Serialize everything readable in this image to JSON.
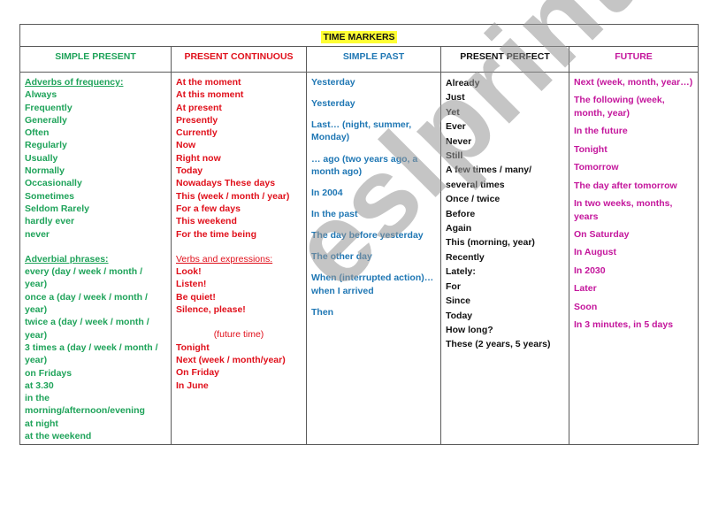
{
  "title": "TIME MARKERS",
  "columns": [
    {
      "heading": "SIMPLE PRESENT",
      "color": "#1fa35a",
      "section1_heading": "Adverbs of frequency:",
      "section1_items": [
        "Always",
        "Frequently",
        "Generally",
        "Often",
        "Regularly",
        "Usually",
        "Normally",
        "Occasionally",
        "Sometimes",
        "Seldom Rarely",
        "hardly ever",
        "never"
      ],
      "section2_heading": "Adverbial phrases:",
      "section2_items": [
        "every (day / week / month / year)",
        "once a (day / week / month / year)",
        "twice a (day / week / month / year)",
        "3 times a (day / week / month / year)",
        "on Fridays",
        "at 3.30",
        "in the morning/afternoon/evening",
        "at night",
        "at the weekend"
      ]
    },
    {
      "heading": "PRESENT CONTINUOUS",
      "color": "#e0101b",
      "section1_items": [
        "At the moment",
        "At this moment",
        "At present",
        "Presently",
        "Currently",
        "Now",
        "Right now",
        "Today",
        "Nowadays These days",
        "This (week / month / year)",
        "For a few days",
        "This weekend",
        "For the time being"
      ],
      "section2_heading": "Verbs and expressions:",
      "section2_items": [
        "Look!",
        "Listen!",
        "Be quiet!",
        "Silence, please!"
      ],
      "section3_heading": "(future time)",
      "section3_items": [
        "Tonight",
        "Next (week / month/year)",
        "On Friday",
        "In June"
      ]
    },
    {
      "heading": "SIMPLE PAST",
      "color": "#1f77b4",
      "items": [
        "Yesterday",
        "Yesterday",
        "Last… (night, summer, Monday)",
        "… ago (two years ago, a month ago)",
        "In 2004",
        "In the past",
        "The day before yesterday",
        "The other day",
        "When (interrupted action)… when I arrived",
        "Then"
      ]
    },
    {
      "heading": "PRESENT PERFECT",
      "color": "#111111",
      "items": [
        "Already",
        "Just",
        "Yet",
        "Ever",
        "Never",
        "Still",
        "A few times / many/ several times",
        "Once / twice",
        "Before",
        "Again",
        "This (morning, year)",
        "Recently",
        "Lately:",
        "For",
        "Since",
        "Today",
        "How long?",
        "These (2 years, 5 years)"
      ]
    },
    {
      "heading": "FUTURE",
      "color": "#c4169c",
      "items": [
        "Next (week, month, year…)",
        "The following (week, month, year)",
        "In the future",
        "Tonight",
        "Tomorrow",
        "The day after tomorrow",
        "In two weeks, months, years",
        "On Saturday",
        "In August",
        "In 2030",
        "Later",
        "Soon",
        "In 3 minutes, in 5 days"
      ]
    }
  ],
  "watermark": "eslprintables.com"
}
